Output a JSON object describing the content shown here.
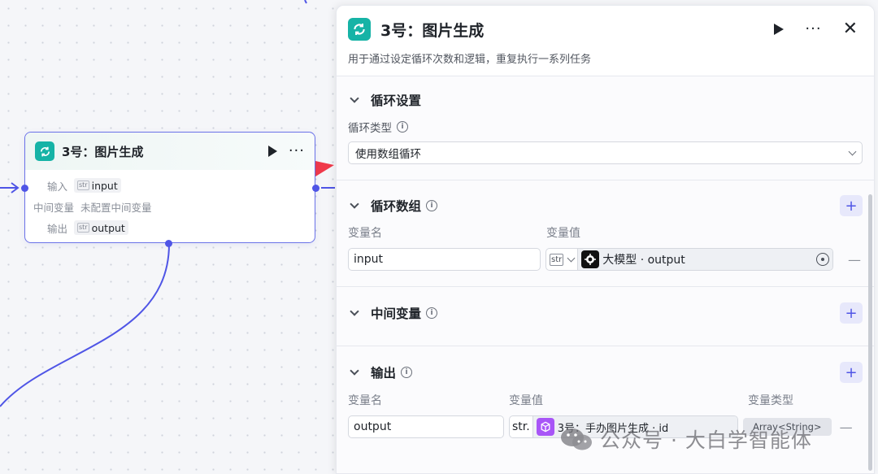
{
  "node": {
    "title": "3号：图片生成",
    "input_label": "输入",
    "input_type": "str",
    "input_value": "input",
    "intermediate_label": "中间变量",
    "intermediate_value": "未配置中间变量",
    "output_label": "输出",
    "output_type": "str",
    "output_value": "output"
  },
  "panel": {
    "title": "3号：图片生成",
    "description": "用于通过设定循环次数和逻辑，重复执行一系列任务",
    "loop_settings": {
      "title": "循环设置",
      "type_label": "循环类型",
      "type_value": "使用数组循环"
    },
    "loop_array": {
      "title": "循环数组",
      "col_name": "变量名",
      "col_value": "变量值",
      "row": {
        "name": "input",
        "type": "str",
        "ref_value": "大模型 · output"
      }
    },
    "intermediate": {
      "title": "中间变量"
    },
    "output": {
      "title": "输出",
      "col_name": "变量名",
      "col_value": "变量值",
      "col_type": "变量类型",
      "row": {
        "name": "output",
        "type": "str.",
        "ref_value": "3号：手办图片生成 · id",
        "var_type": "Array<String>"
      }
    }
  },
  "watermark": "公众号 · 大白学智能体",
  "colors": {
    "accent": "#4f55e6",
    "node_icon": "#16b3a6",
    "arrow": "#f0394a",
    "llm_icon": "#111111",
    "cube_icon": "#a855f7"
  },
  "icons": [
    "loop-icon",
    "play-icon",
    "more-icon",
    "close-icon",
    "chevron-down-icon",
    "info-icon",
    "plus-icon",
    "llm-icon",
    "cube-icon",
    "target-icon",
    "minus-icon"
  ]
}
